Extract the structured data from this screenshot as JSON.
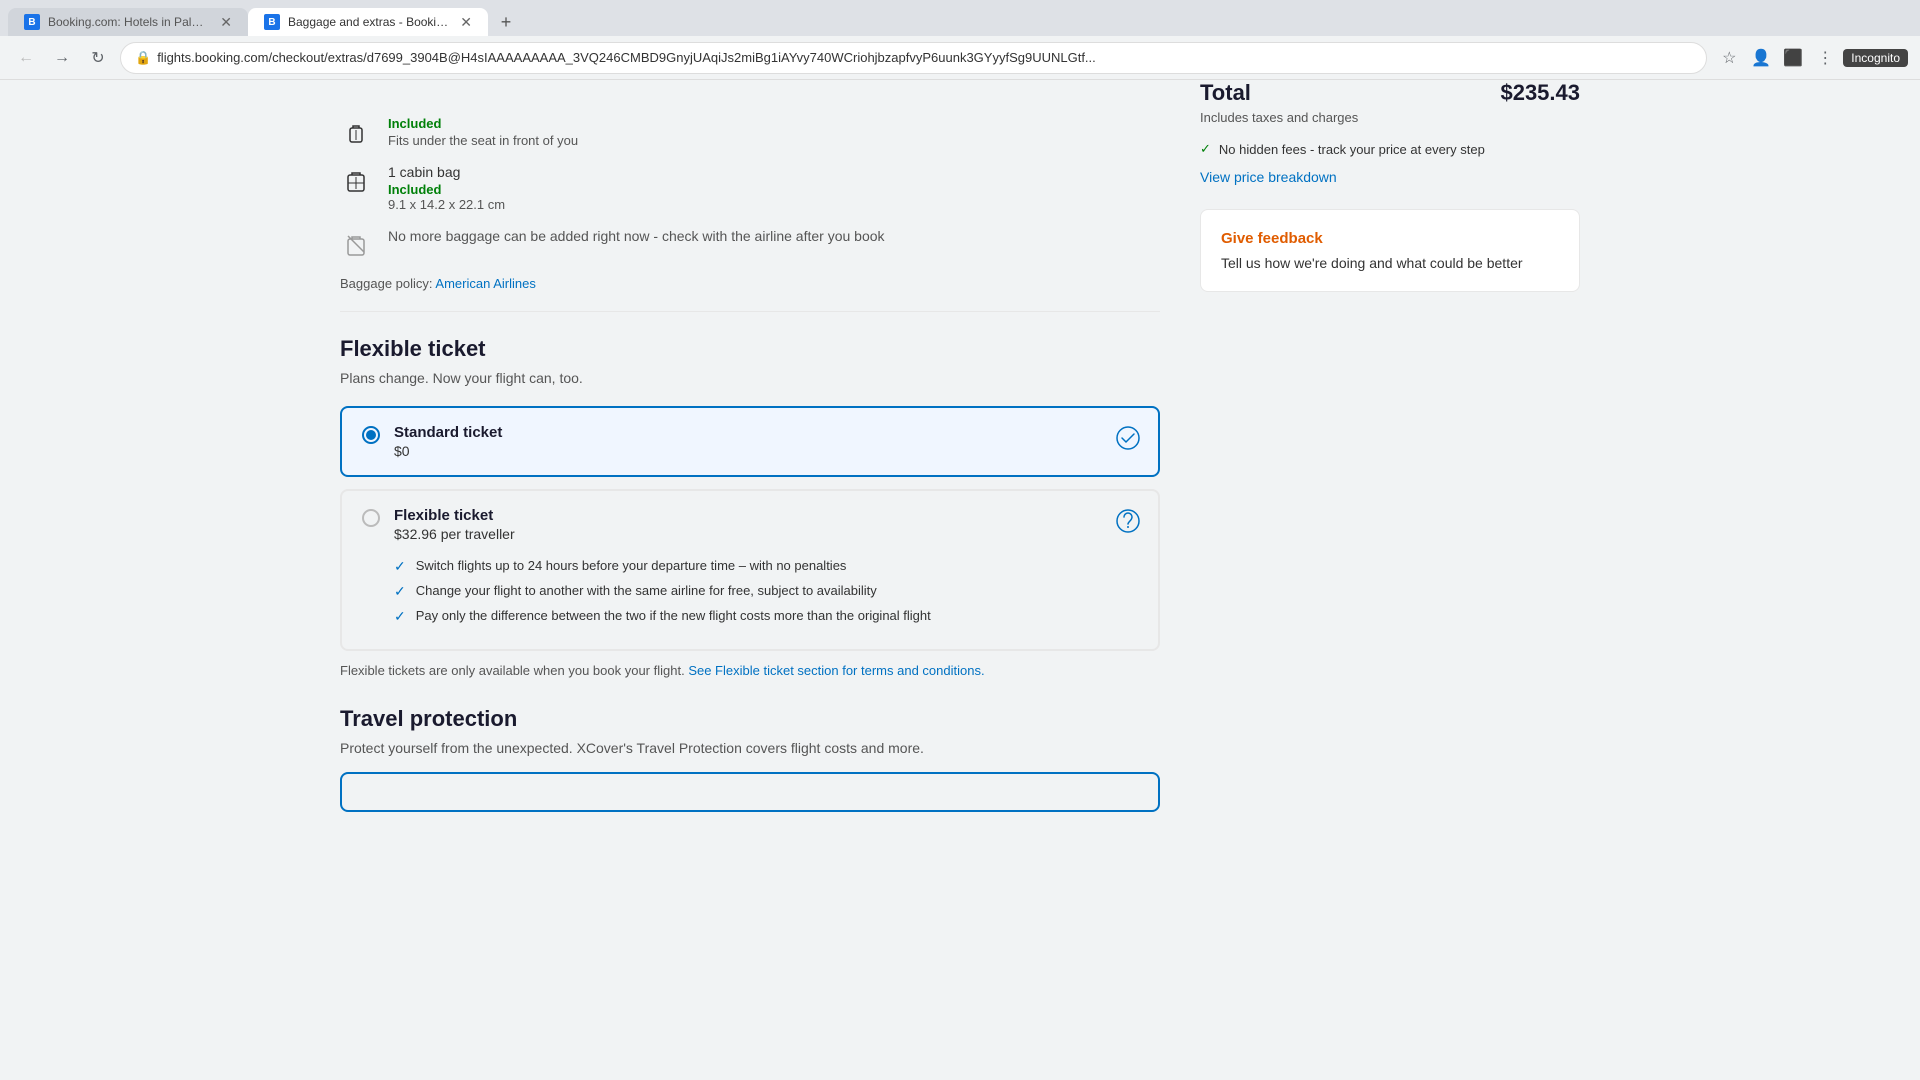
{
  "browser": {
    "tabs": [
      {
        "id": "tab1",
        "favicon": "B",
        "title": "Booking.com: Hotels in Palm Sp...",
        "active": false
      },
      {
        "id": "tab2",
        "favicon": "B",
        "title": "Baggage and extras - Booking...",
        "active": true
      }
    ],
    "address": "flights.booking.com/checkout/extras/d7699_3904B@H4sIAAAAAAAAA_3VQ246CMBD9GnyjUAqiJs2miBg1iAYvy740WCriohjbzapfvyP6uunk3GYyyfSg9UUNLGtf...",
    "incognito_label": "Incognito"
  },
  "baggage": {
    "included_label": "Included",
    "fits_text": "Fits under the seat in front of you",
    "cabin_bag_name": "1 cabin bag",
    "cabin_bag_included": "Included",
    "cabin_bag_size": "9.1 x 14.2 x 22.1 cm",
    "no_baggage_text": "No more baggage can be added right now - check with the airline after you book",
    "policy_prefix": "Baggage policy:",
    "policy_airline": "American Airlines"
  },
  "flexible_ticket": {
    "section_title": "Flexible ticket",
    "section_subtitle": "Plans change. Now your flight can, too.",
    "options": [
      {
        "name": "Standard ticket",
        "price": "$0",
        "selected": true,
        "features": []
      },
      {
        "name": "Flexible ticket",
        "price": "$32.96 per traveller",
        "selected": false,
        "features": [
          "Switch flights up to 24 hours before your departure time – with no penalties",
          "Change your flight to another with the same airline for free, subject to availability",
          "Pay only the difference between the two if the new flight costs more than the original flight"
        ]
      }
    ],
    "terms_prefix": "Flexible tickets are only available when you book your flight.",
    "terms_link": "See Flexible ticket section for terms and conditions."
  },
  "travel_protection": {
    "section_title": "Travel protection",
    "section_subtitle": "Protect yourself from the unexpected. XCover's Travel Protection covers flight costs and more."
  },
  "sidebar": {
    "total_label": "Total",
    "total_amount": "$235.43",
    "taxes_text": "Includes taxes and charges",
    "no_hidden_fees": "No hidden fees - track your price at every step",
    "view_breakdown": "View price breakdown",
    "feedback": {
      "title": "Give feedback",
      "text": "Tell us how we're doing and what could be better"
    }
  }
}
